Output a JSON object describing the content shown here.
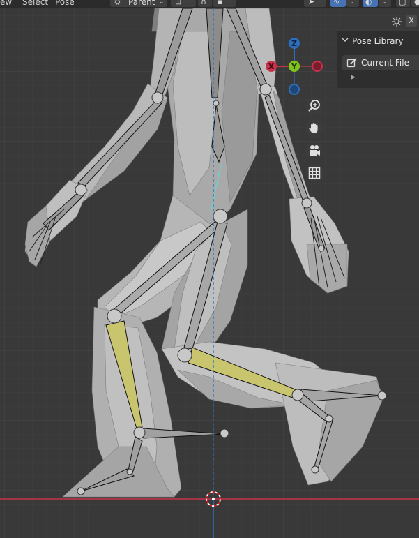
{
  "header": {
    "menu_view": "ew",
    "menu_select": "Select",
    "menu_pose": "Pose",
    "pivot_label": "Parent"
  },
  "gizmo": {
    "x": "X",
    "y": "Y",
    "z": "Z"
  },
  "sidebar": {
    "close_label": "X",
    "panel_title": "Pose Library",
    "library_value": "Current File"
  },
  "colors": {
    "grid_bg": "#393939",
    "axis_x": "#c8324a",
    "axis_y": "#7fc41b",
    "axis_z": "#2b6fbd",
    "selected_bone": "#c9c46e",
    "active_header_button": "#4772b3"
  },
  "icons": [
    "zoom-icon",
    "hand-pan-icon",
    "camera-icon",
    "grid-ortho-icon",
    "pin-icon",
    "edit-icon",
    "chevron-down-icon",
    "chevron-right-icon",
    "3d-cursor-icon"
  ]
}
